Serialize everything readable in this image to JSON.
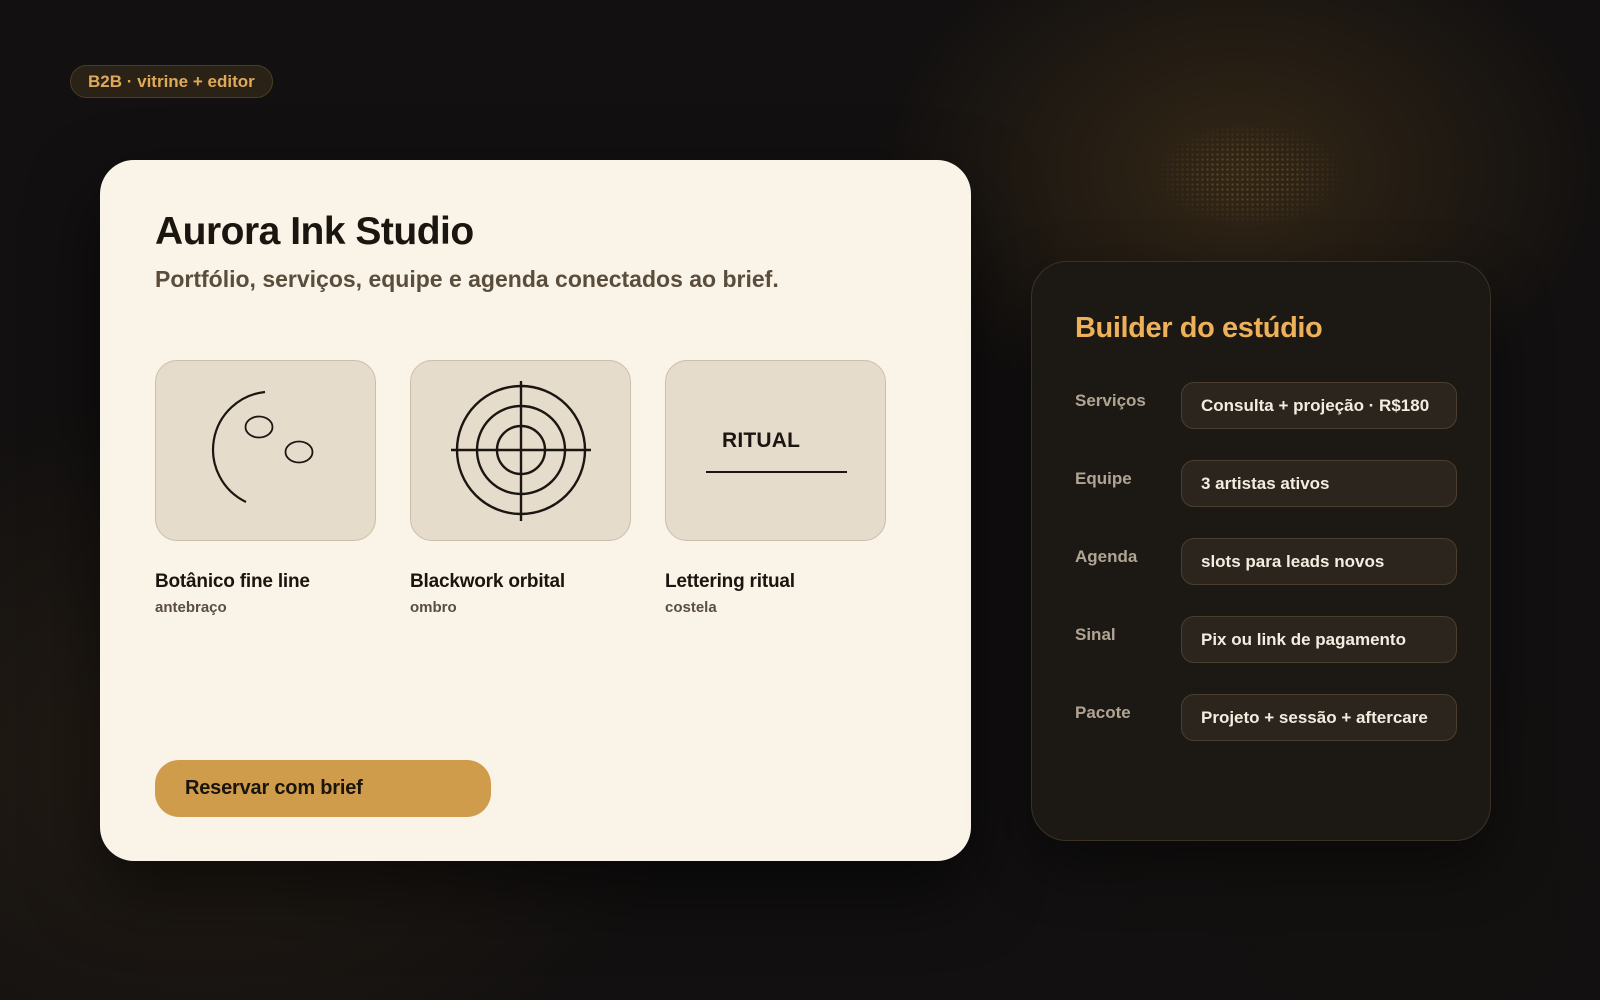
{
  "badge": "B2B · vitrine + editor",
  "showcase": {
    "title": "Aurora Ink Studio",
    "subtitle": "Portfólio, serviços, equipe e agenda conectados ao brief.",
    "items": [
      {
        "name": "Botânico fine line",
        "placement": "antebraço",
        "art": "botanical-fine-line-art"
      },
      {
        "name": "Blackwork orbital",
        "placement": "ombro",
        "art": "orbital-target-art"
      },
      {
        "name": "Lettering ritual",
        "placement": "costela",
        "art_text": "RITUAL"
      }
    ],
    "cta": "Reservar com brief"
  },
  "builder": {
    "title": "Builder do estúdio",
    "rows": [
      {
        "label": "Serviços",
        "value": "Consulta + projeção · R$180"
      },
      {
        "label": "Equipe",
        "value": "3 artistas ativos"
      },
      {
        "label": "Agenda",
        "value": "slots para leads novos"
      },
      {
        "label": "Sinal",
        "value": "Pix ou link de pagamento"
      },
      {
        "label": "Pacote",
        "value": "Projeto + sessão + aftercare"
      }
    ]
  },
  "colors": {
    "background": "#121010",
    "card": "#f9f3e8",
    "tile": "#e5dccc",
    "accent": "#cf9c4c",
    "builder_title": "#eeb059",
    "builder_panel": "#1c1814"
  }
}
